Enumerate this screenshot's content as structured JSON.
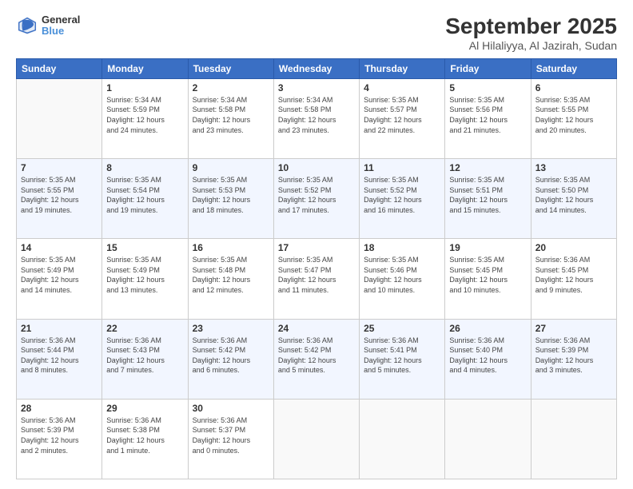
{
  "logo": {
    "line1": "General",
    "line2": "Blue"
  },
  "title": "September 2025",
  "subtitle": "Al Hilaliyya, Al Jazirah, Sudan",
  "days_of_week": [
    "Sunday",
    "Monday",
    "Tuesday",
    "Wednesday",
    "Thursday",
    "Friday",
    "Saturday"
  ],
  "weeks": [
    [
      {
        "day": "",
        "info": ""
      },
      {
        "day": "1",
        "info": "Sunrise: 5:34 AM\nSunset: 5:59 PM\nDaylight: 12 hours\nand 24 minutes."
      },
      {
        "day": "2",
        "info": "Sunrise: 5:34 AM\nSunset: 5:58 PM\nDaylight: 12 hours\nand 23 minutes."
      },
      {
        "day": "3",
        "info": "Sunrise: 5:34 AM\nSunset: 5:58 PM\nDaylight: 12 hours\nand 23 minutes."
      },
      {
        "day": "4",
        "info": "Sunrise: 5:35 AM\nSunset: 5:57 PM\nDaylight: 12 hours\nand 22 minutes."
      },
      {
        "day": "5",
        "info": "Sunrise: 5:35 AM\nSunset: 5:56 PM\nDaylight: 12 hours\nand 21 minutes."
      },
      {
        "day": "6",
        "info": "Sunrise: 5:35 AM\nSunset: 5:55 PM\nDaylight: 12 hours\nand 20 minutes."
      }
    ],
    [
      {
        "day": "7",
        "info": "Sunrise: 5:35 AM\nSunset: 5:55 PM\nDaylight: 12 hours\nand 19 minutes."
      },
      {
        "day": "8",
        "info": "Sunrise: 5:35 AM\nSunset: 5:54 PM\nDaylight: 12 hours\nand 19 minutes."
      },
      {
        "day": "9",
        "info": "Sunrise: 5:35 AM\nSunset: 5:53 PM\nDaylight: 12 hours\nand 18 minutes."
      },
      {
        "day": "10",
        "info": "Sunrise: 5:35 AM\nSunset: 5:52 PM\nDaylight: 12 hours\nand 17 minutes."
      },
      {
        "day": "11",
        "info": "Sunrise: 5:35 AM\nSunset: 5:52 PM\nDaylight: 12 hours\nand 16 minutes."
      },
      {
        "day": "12",
        "info": "Sunrise: 5:35 AM\nSunset: 5:51 PM\nDaylight: 12 hours\nand 15 minutes."
      },
      {
        "day": "13",
        "info": "Sunrise: 5:35 AM\nSunset: 5:50 PM\nDaylight: 12 hours\nand 14 minutes."
      }
    ],
    [
      {
        "day": "14",
        "info": "Sunrise: 5:35 AM\nSunset: 5:49 PM\nDaylight: 12 hours\nand 14 minutes."
      },
      {
        "day": "15",
        "info": "Sunrise: 5:35 AM\nSunset: 5:49 PM\nDaylight: 12 hours\nand 13 minutes."
      },
      {
        "day": "16",
        "info": "Sunrise: 5:35 AM\nSunset: 5:48 PM\nDaylight: 12 hours\nand 12 minutes."
      },
      {
        "day": "17",
        "info": "Sunrise: 5:35 AM\nSunset: 5:47 PM\nDaylight: 12 hours\nand 11 minutes."
      },
      {
        "day": "18",
        "info": "Sunrise: 5:35 AM\nSunset: 5:46 PM\nDaylight: 12 hours\nand 10 minutes."
      },
      {
        "day": "19",
        "info": "Sunrise: 5:35 AM\nSunset: 5:45 PM\nDaylight: 12 hours\nand 10 minutes."
      },
      {
        "day": "20",
        "info": "Sunrise: 5:36 AM\nSunset: 5:45 PM\nDaylight: 12 hours\nand 9 minutes."
      }
    ],
    [
      {
        "day": "21",
        "info": "Sunrise: 5:36 AM\nSunset: 5:44 PM\nDaylight: 12 hours\nand 8 minutes."
      },
      {
        "day": "22",
        "info": "Sunrise: 5:36 AM\nSunset: 5:43 PM\nDaylight: 12 hours\nand 7 minutes."
      },
      {
        "day": "23",
        "info": "Sunrise: 5:36 AM\nSunset: 5:42 PM\nDaylight: 12 hours\nand 6 minutes."
      },
      {
        "day": "24",
        "info": "Sunrise: 5:36 AM\nSunset: 5:42 PM\nDaylight: 12 hours\nand 5 minutes."
      },
      {
        "day": "25",
        "info": "Sunrise: 5:36 AM\nSunset: 5:41 PM\nDaylight: 12 hours\nand 5 minutes."
      },
      {
        "day": "26",
        "info": "Sunrise: 5:36 AM\nSunset: 5:40 PM\nDaylight: 12 hours\nand 4 minutes."
      },
      {
        "day": "27",
        "info": "Sunrise: 5:36 AM\nSunset: 5:39 PM\nDaylight: 12 hours\nand 3 minutes."
      }
    ],
    [
      {
        "day": "28",
        "info": "Sunrise: 5:36 AM\nSunset: 5:39 PM\nDaylight: 12 hours\nand 2 minutes."
      },
      {
        "day": "29",
        "info": "Sunrise: 5:36 AM\nSunset: 5:38 PM\nDaylight: 12 hours\nand 1 minute."
      },
      {
        "day": "30",
        "info": "Sunrise: 5:36 AM\nSunset: 5:37 PM\nDaylight: 12 hours\nand 0 minutes."
      },
      {
        "day": "",
        "info": ""
      },
      {
        "day": "",
        "info": ""
      },
      {
        "day": "",
        "info": ""
      },
      {
        "day": "",
        "info": ""
      }
    ]
  ]
}
